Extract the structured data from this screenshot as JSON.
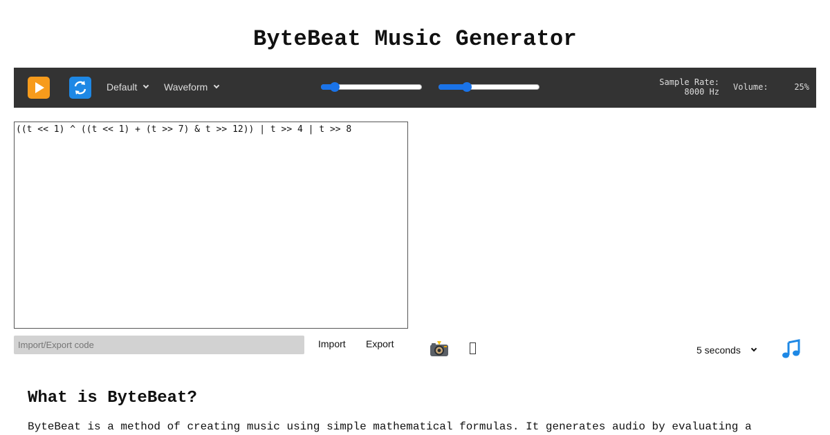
{
  "page": {
    "title": "ByteBeat Music Generator"
  },
  "toolbar": {
    "play_icon": "play-icon",
    "loop_icon": "loop-icon",
    "style_select": {
      "selected": "Default"
    },
    "mode_select": {
      "selected": "Waveform"
    },
    "sample_rate_slider": {
      "fraction": 0.14
    },
    "volume_slider": {
      "fraction": 0.28
    },
    "sample_rate_label": "Sample Rate:",
    "sample_rate_value": "8000 Hz",
    "volume_label": "Volume:",
    "volume_value": "25%",
    "colors": {
      "bar": "#333333",
      "accent": "#1a73e8",
      "play": "#f79b1c",
      "loop": "#1e88e5"
    }
  },
  "editor": {
    "code": "((t << 1) ^ ((t << 1) + (t >> 7) & t >> 12)) | t >> 4 | t >> 8"
  },
  "io": {
    "placeholder": "Import/Export code",
    "import_label": "Import",
    "export_label": "Export",
    "camera_icon": "camera-icon",
    "duration": {
      "selected": "5 seconds"
    },
    "download_icon": "music-note-icon"
  },
  "about": {
    "heading": "What is ByteBeat?",
    "text": "ByteBeat is a method of creating music using simple mathematical formulas. It generates audio by evaluating a"
  }
}
